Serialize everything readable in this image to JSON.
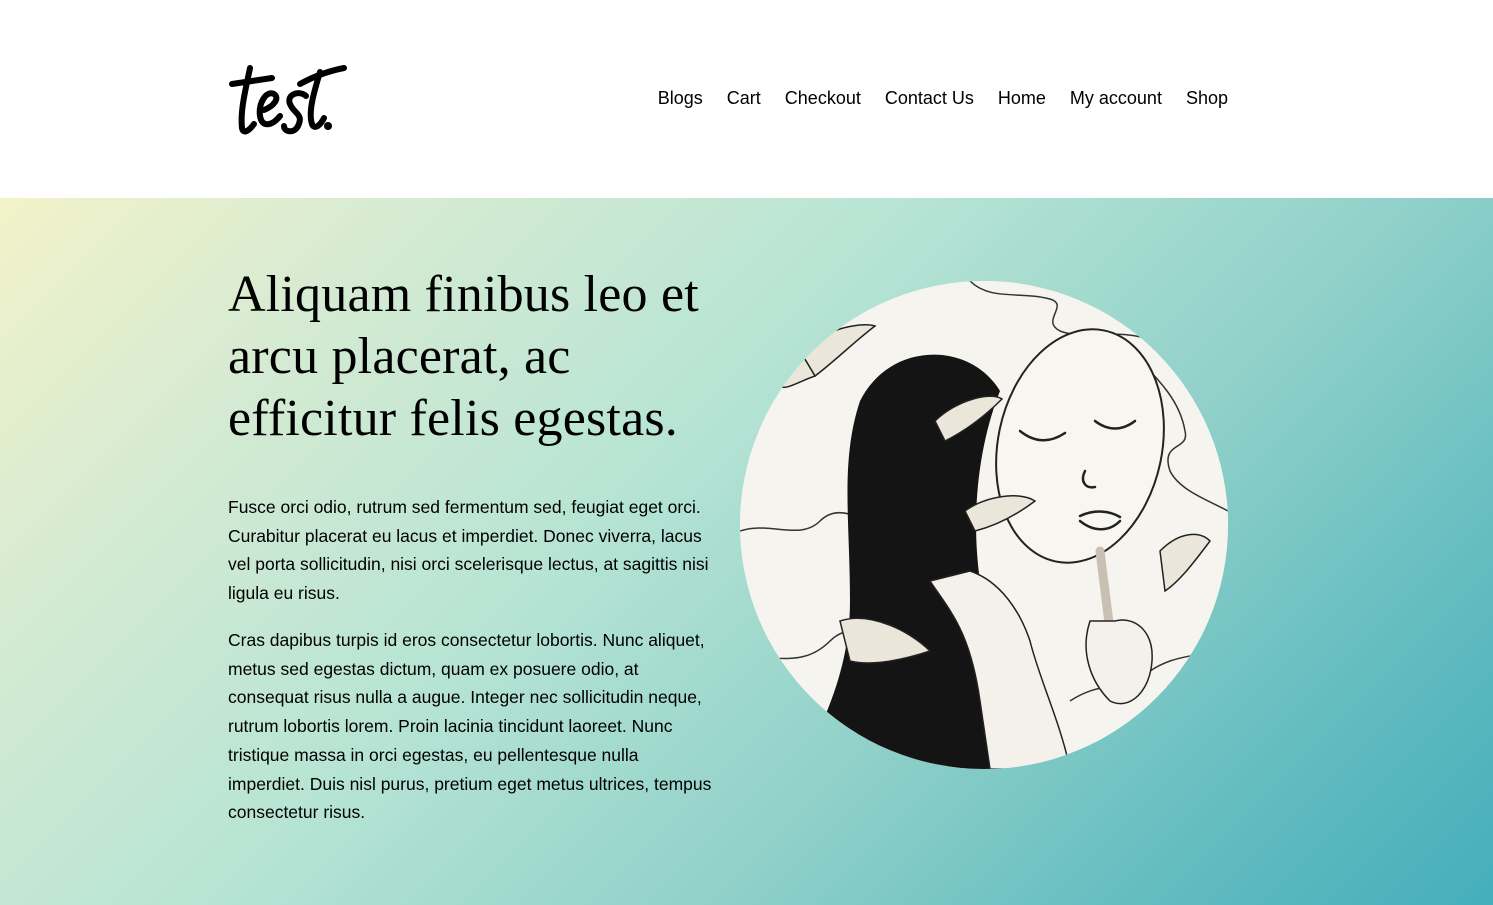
{
  "header": {
    "logo_text": "test.",
    "nav": [
      "Blogs",
      "Cart",
      "Checkout",
      "Contact Us",
      "Home",
      "My account",
      "Shop"
    ]
  },
  "hero": {
    "title": "Aliquam finibus leo et arcu placerat, ac efficitur felis egestas.",
    "paragraphs": [
      "Fusce orci odio, rutrum sed fermentum sed, feugiat eget orci. Curabitur placerat eu lacus et imperdiet. Donec viverra, lacus vel porta sollicitudin, nisi orci scelerisque lectus, at sagittis nisi ligula eu risus.",
      "Cras dapibus turpis id eros consectetur lobortis. Nunc aliquet, metus sed egestas dictum, quam ex posuere odio, at consequat risus nulla a augue. Integer nec sollicitudin neque, rutrum lobortis lorem. Proin lacinia tincidunt laoreet. Nunc tristique massa in orci egestas, eu pellentesque nulla imperdiet. Duis nisl purus, pretium eget metus ultrices, tempus consectetur risus."
    ],
    "image_subject": "ink-illustration-woman-mask-butterflies"
  },
  "colors": {
    "gradient_start": "#f2f2c8",
    "gradient_end": "#45aebb",
    "text": "#000000"
  }
}
